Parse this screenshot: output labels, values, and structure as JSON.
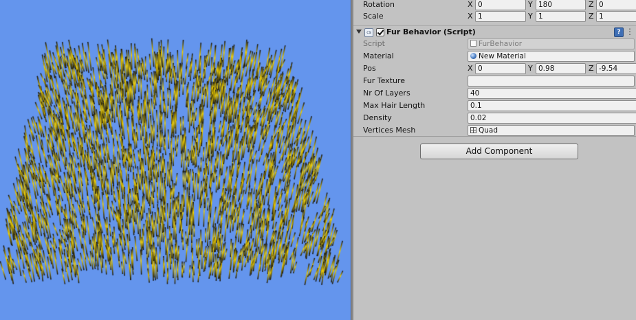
{
  "transform": {
    "rotation": {
      "label": "Rotation",
      "x": "0",
      "y": "180",
      "z": "0"
    },
    "scale": {
      "label": "Scale",
      "x": "1",
      "y": "1",
      "z": "1"
    }
  },
  "axes": {
    "x": "X",
    "y": "Y",
    "z": "Z"
  },
  "component": {
    "title": "Fur Behavior (Script)",
    "enabled": true,
    "script_icon_text": "cs",
    "help_glyph": "?",
    "gear_glyph": "⋮",
    "fields": {
      "script": {
        "label": "Script",
        "value": "FurBehavior",
        "icon": "script-file-icon"
      },
      "material": {
        "label": "Material",
        "value": "New Material",
        "icon": "material-sphere-icon"
      },
      "pos": {
        "label": "Pos",
        "x": "0",
        "y": "0.98",
        "z": "-9.54"
      },
      "fur_texture": {
        "label": "Fur Texture",
        "value": ""
      },
      "nr_of_layers": {
        "label": "Nr Of Layers",
        "value": "40"
      },
      "max_hair_length": {
        "label": "Max Hair Length",
        "value": "0.1"
      },
      "density": {
        "label": "Density",
        "value": "0.02"
      },
      "vertices_mesh": {
        "label": "Vertices Mesh",
        "value": "Quad",
        "icon": "mesh-grid-icon"
      }
    }
  },
  "add_component_label": "Add Component",
  "colors": {
    "viewport_background": "#6495ed",
    "fur_tip": "#f2d000",
    "fur_root": "#111111",
    "inspector_background": "#c2c2c2"
  }
}
